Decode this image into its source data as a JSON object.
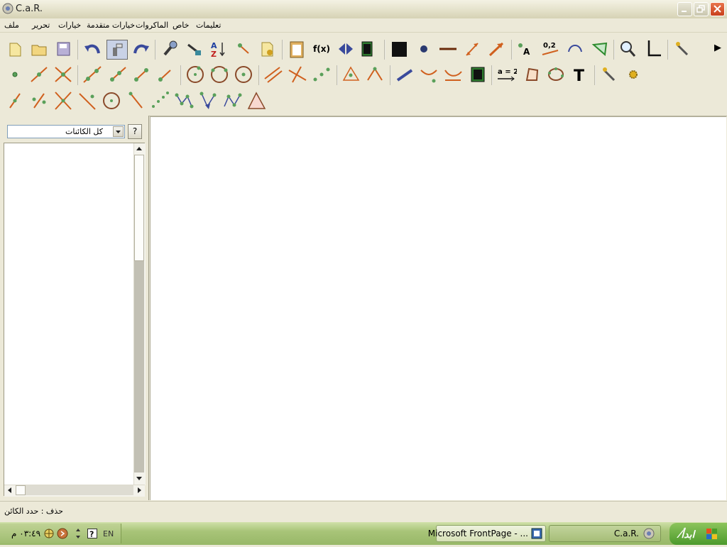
{
  "window": {
    "title": "C.a.R."
  },
  "menu": {
    "items": [
      "ملف",
      "تحرير",
      "خيارات",
      "خيارات متقدمة",
      "الماكروات",
      "خاص",
      "تعليمات"
    ]
  },
  "toolbar": {
    "overflow_arrow": "▶",
    "text_labels": {
      "fx": "f(x)",
      "label_a": "A",
      "num": "0,2",
      "assign": "a = 2",
      "text_tool": "T"
    }
  },
  "left_panel": {
    "filter_selected": "كل الكائنات",
    "help_label": "?"
  },
  "status": {
    "text": "حذف : حدد الكائن"
  },
  "taskbar": {
    "clock": "٠٣:٤٩ م",
    "language": "EN",
    "tasks": [
      "Microsoft FrontPage - ...",
      "C.a.R."
    ]
  },
  "colors": {
    "accent_green": "#2e8b2e",
    "accent_orange": "#d0601e",
    "point_fill": "#5aa05a"
  }
}
